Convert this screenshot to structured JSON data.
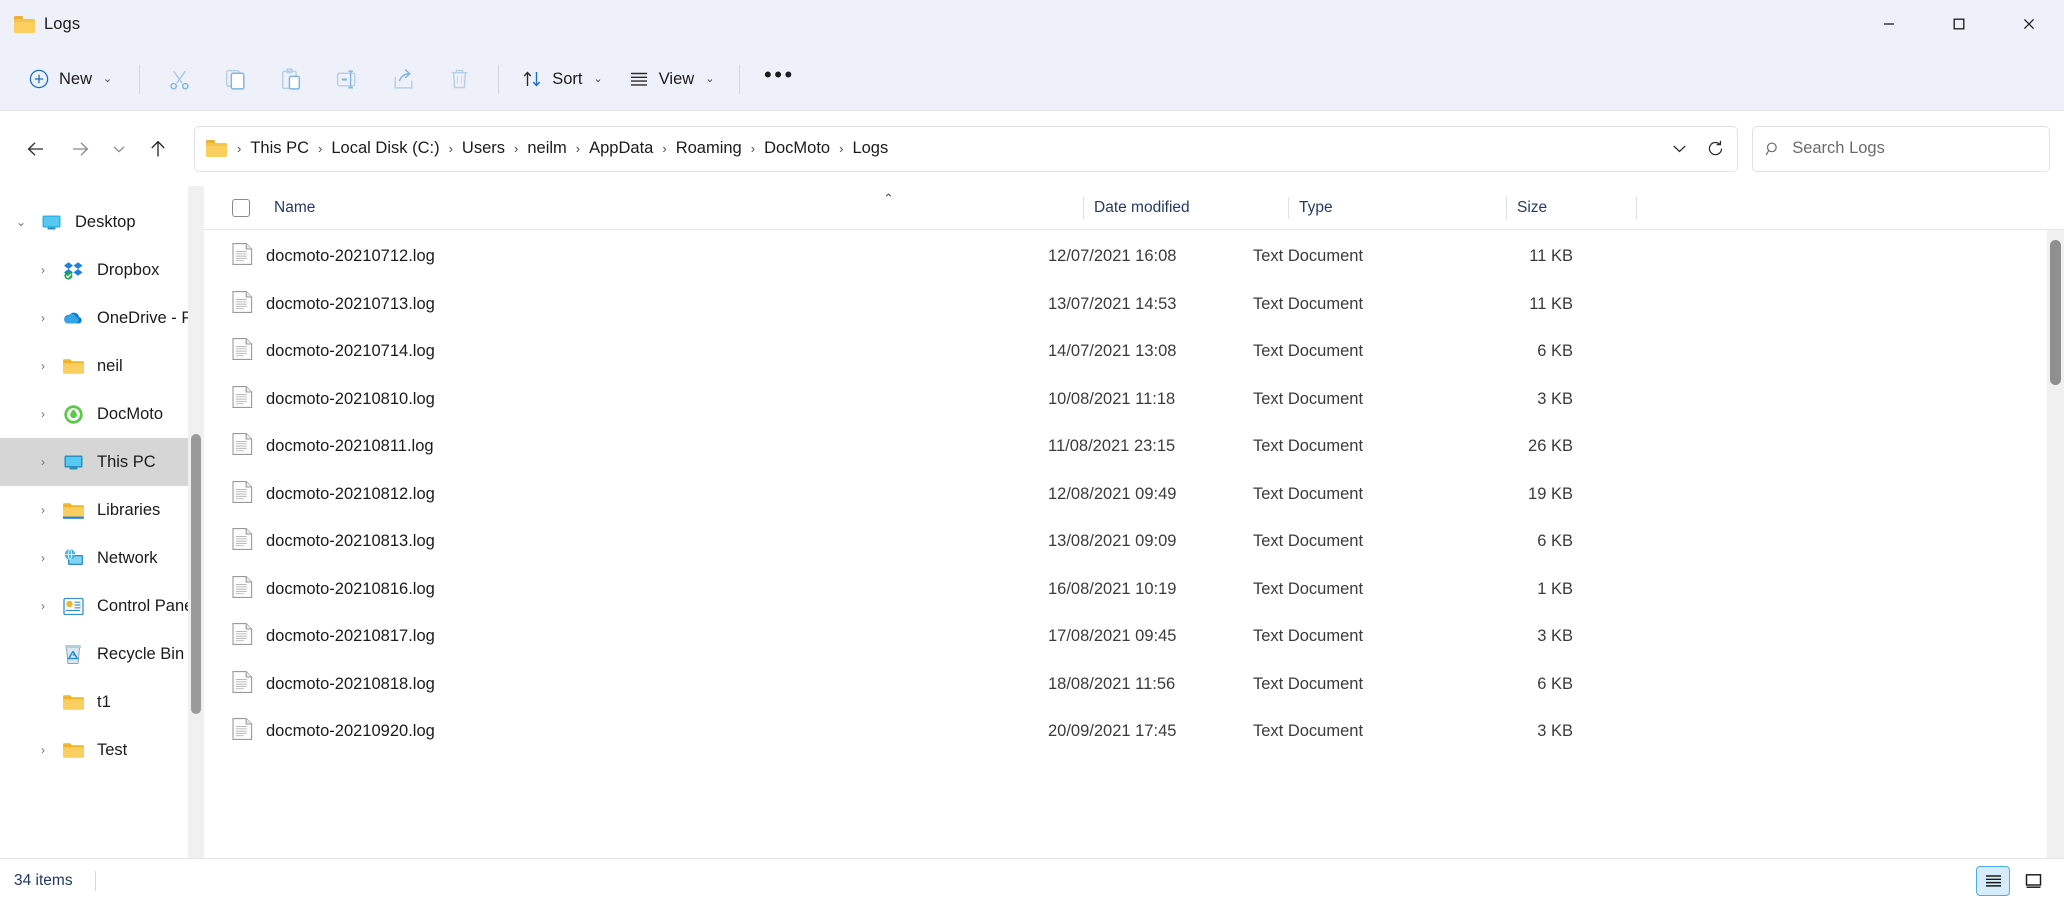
{
  "window": {
    "title": "Logs",
    "folder_icon": "folder-icon",
    "controls": {
      "minimize": "minimize-icon",
      "maximize": "maximize-icon",
      "close": "close-icon"
    }
  },
  "toolbar": {
    "new_label": "New",
    "cut_label": "cut-icon",
    "copy_label": "copy-icon",
    "paste_label": "paste-icon",
    "rename_label": "rename-icon",
    "share_label": "share-icon",
    "delete_label": "delete-icon",
    "sort_label": "Sort",
    "view_label": "View",
    "more_label": "more-options-icon"
  },
  "navigation": {
    "back": "back-arrow-icon",
    "forward": "forward-arrow-icon",
    "recent": "recent-locations-icon",
    "up": "up-arrow-icon",
    "refresh": "refresh-icon",
    "path_dropdown": "chevron-down-icon",
    "breadcrumbs": [
      "This PC",
      "Local Disk (C:)",
      "Users",
      "neilm",
      "AppData",
      "Roaming",
      "DocMoto",
      "Logs"
    ]
  },
  "search": {
    "placeholder": "Search Logs",
    "value": "",
    "icon": "search-icon"
  },
  "sidebar": {
    "items": [
      {
        "label": "Desktop",
        "level": 0,
        "expander": "down",
        "icon": "desktop-icon",
        "selected": false
      },
      {
        "label": "Dropbox",
        "level": 1,
        "expander": "right",
        "icon": "dropbox-icon",
        "selected": false
      },
      {
        "label": "OneDrive - Pers",
        "level": 1,
        "expander": "right",
        "icon": "onedrive-icon",
        "selected": false
      },
      {
        "label": "neil",
        "level": 1,
        "expander": "right",
        "icon": "folder-icon",
        "selected": false
      },
      {
        "label": "DocMoto",
        "level": 1,
        "expander": "right",
        "icon": "docmoto-icon",
        "selected": false
      },
      {
        "label": "This PC",
        "level": 1,
        "expander": "right",
        "icon": "this-pc-icon",
        "selected": true
      },
      {
        "label": "Libraries",
        "level": 1,
        "expander": "right",
        "icon": "libraries-icon",
        "selected": false
      },
      {
        "label": "Network",
        "level": 1,
        "expander": "right",
        "icon": "network-icon",
        "selected": false
      },
      {
        "label": "Control Panel",
        "level": 1,
        "expander": "right",
        "icon": "control-panel-icon",
        "selected": false
      },
      {
        "label": "Recycle Bin",
        "level": 1,
        "expander": "none",
        "icon": "recycle-bin-icon",
        "selected": false
      },
      {
        "label": "t1",
        "level": 1,
        "expander": "none",
        "icon": "folder-icon",
        "selected": false
      },
      {
        "label": "Test",
        "level": 1,
        "expander": "right",
        "icon": "folder-icon",
        "selected": false
      }
    ]
  },
  "filelist": {
    "select_all_checkbox": false,
    "sort_indicator": "ascending",
    "columns": [
      "Name",
      "Date modified",
      "Type",
      "Size"
    ],
    "rows": [
      {
        "name": "docmoto-20210712.log",
        "date": "12/07/2021 16:08",
        "type": "Text Document",
        "size": "11 KB"
      },
      {
        "name": "docmoto-20210713.log",
        "date": "13/07/2021 14:53",
        "type": "Text Document",
        "size": "11 KB"
      },
      {
        "name": "docmoto-20210714.log",
        "date": "14/07/2021 13:08",
        "type": "Text Document",
        "size": "6 KB"
      },
      {
        "name": "docmoto-20210810.log",
        "date": "10/08/2021 11:18",
        "type": "Text Document",
        "size": "3 KB"
      },
      {
        "name": "docmoto-20210811.log",
        "date": "11/08/2021 23:15",
        "type": "Text Document",
        "size": "26 KB"
      },
      {
        "name": "docmoto-20210812.log",
        "date": "12/08/2021 09:49",
        "type": "Text Document",
        "size": "19 KB"
      },
      {
        "name": "docmoto-20210813.log",
        "date": "13/08/2021 09:09",
        "type": "Text Document",
        "size": "6 KB"
      },
      {
        "name": "docmoto-20210816.log",
        "date": "16/08/2021 10:19",
        "type": "Text Document",
        "size": "1 KB"
      },
      {
        "name": "docmoto-20210817.log",
        "date": "17/08/2021 09:45",
        "type": "Text Document",
        "size": "3 KB"
      },
      {
        "name": "docmoto-20210818.log",
        "date": "18/08/2021 11:56",
        "type": "Text Document",
        "size": "6 KB"
      },
      {
        "name": "docmoto-20210920.log",
        "date": "20/09/2021 17:45",
        "type": "Text Document",
        "size": "3 KB"
      }
    ]
  },
  "statusbar": {
    "item_count": "34 items",
    "view_details": "details-view-icon",
    "view_large": "large-icons-view-icon",
    "active_view": "details"
  },
  "colors": {
    "chrome": "#eef1f9",
    "accent": "#0078d4",
    "folder_yellow": "#fbcf5f",
    "selection_gray": "#d6d6d6",
    "header_text": "#243a63"
  }
}
